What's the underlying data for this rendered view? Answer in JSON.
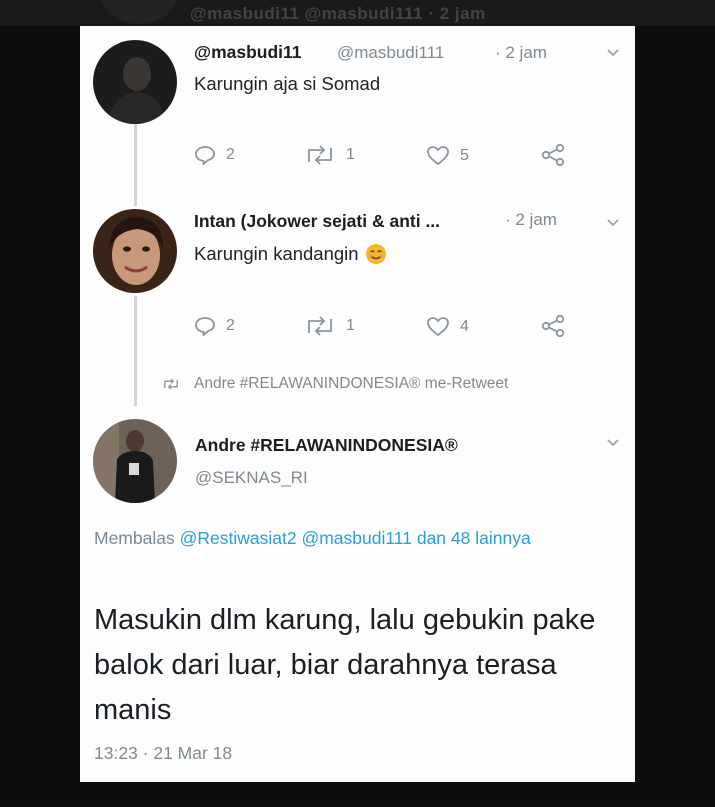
{
  "ghost_header": {
    "text": "@masbudi11 @masbudi111 · 2 jam"
  },
  "tweets": [
    {
      "display_name": "@masbudi11",
      "handle": "@masbudi111",
      "time": "· 2 jam",
      "text": "Karungin aja si Somad",
      "actions": {
        "replies": "2",
        "retweets": "1",
        "likes": "5"
      }
    },
    {
      "display_name": "Intan (Jokower sejati & anti ...",
      "time": "· 2 jam",
      "text": "Karungin kandangin",
      "emoji": "smiling-face-emoji",
      "actions": {
        "replies": "2",
        "retweets": "1",
        "likes": "4"
      }
    }
  ],
  "retweet_note": "Andre #RELAWANINDONESIA® me-Retweet",
  "main_tweet": {
    "display_name": "Andre #RELAWANINDONESIA®",
    "handle": "@SEKNAS_RI",
    "reply_prefix": "Membalas",
    "reply_users": "@Restiwasiat2 @masbudi111",
    "reply_suffix": "dan 48 lainnya",
    "text": "Masukin dlm karung, lalu gebukin pake balok dari luar, biar darahnya terasa manis",
    "timestamp": "13:23 · 21 Mar 18"
  },
  "icons": {
    "reply": "reply-icon",
    "retweet": "retweet-icon",
    "like": "heart-icon",
    "share": "share-icon",
    "menu": "chevron-down-icon"
  },
  "colors": {
    "background": "#0d0d0d",
    "card": "#fdfdfd",
    "text": "#1a1f24",
    "muted": "#7e8a94",
    "link": "#2a9fd6",
    "thread_line": "#cfd6dc"
  }
}
